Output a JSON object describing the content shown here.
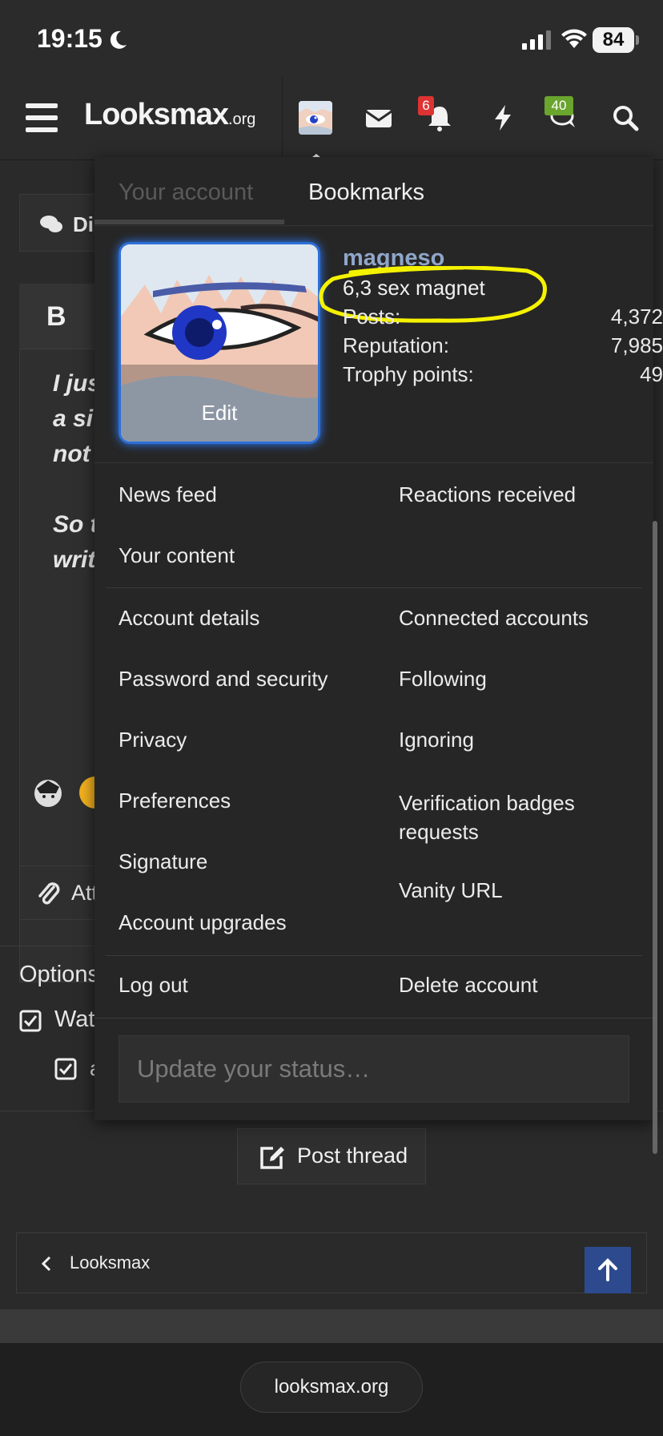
{
  "status_bar": {
    "time": "19:15",
    "battery": "84"
  },
  "header": {
    "logo_main": "Looksmax",
    "logo_suffix": ".org",
    "notifications_badge": "6",
    "conversations_badge": "40"
  },
  "background": {
    "tab_fragment": "Di",
    "editor_fragment": "B",
    "text_lines": [
      "I jus",
      "a si",
      "not",
      "So t",
      "writ"
    ],
    "attach_fragment": "Att",
    "options_fragment": "Options",
    "watch_fragment": "Wat",
    "a_fragment": "a"
  },
  "menu": {
    "tabs": [
      "Your account",
      "Bookmarks"
    ],
    "profile": {
      "username": "magneso",
      "user_title": "6,3 sex magnet",
      "avatar_edit": "Edit",
      "stats": [
        {
          "label": "Posts:",
          "value": "4,372"
        },
        {
          "label": "Reputation:",
          "value": "7,985"
        },
        {
          "label": "Trophy points:",
          "value": "49"
        }
      ]
    },
    "links": {
      "news_feed": "News feed",
      "reactions_received": "Reactions received",
      "your_content": "Your content",
      "account_details": "Account details",
      "connected_accounts": "Connected accounts",
      "password_security": "Password and security",
      "following": "Following",
      "privacy": "Privacy",
      "ignoring": "Ignoring",
      "preferences": "Preferences",
      "verification_badges_1": "Verification badges",
      "verification_badges_2": "requests",
      "signature": "Signature",
      "vanity_url": "Vanity URL",
      "account_upgrades": "Account upgrades",
      "log_out": "Log out",
      "delete_account": "Delete account"
    },
    "status_placeholder": "Update your status…"
  },
  "post_thread": "Post thread",
  "breadcrumb": "Looksmax",
  "footer_url": "looksmax.org",
  "colors": {
    "accent_blue": "#2d4a8f",
    "username": "#8fa6c9",
    "highlight": "#f5f200",
    "badge_red": "#dd3333",
    "badge_green": "#6aa52e"
  }
}
